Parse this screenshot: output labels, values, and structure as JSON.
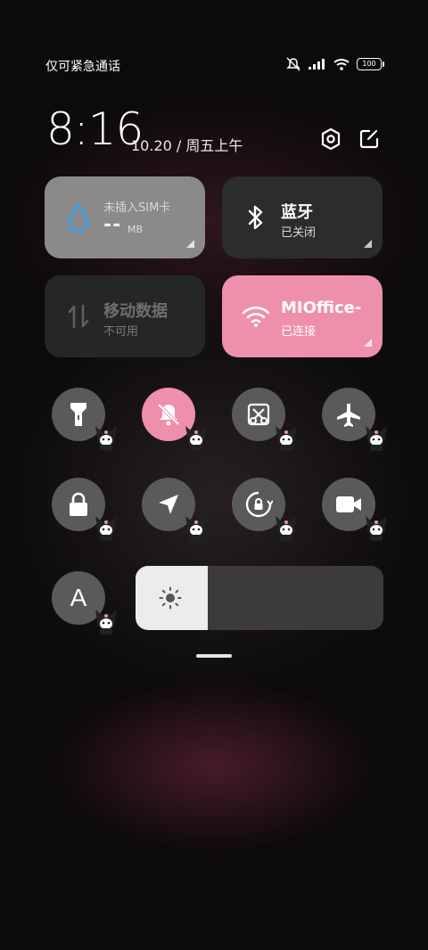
{
  "status_bar": {
    "carrier": "仅可紧急通话",
    "battery": "100"
  },
  "header": {
    "time": "8:16",
    "date": "10.20 / 周五上午"
  },
  "tiles": {
    "data_usage": {
      "title": "未插入SIM卡",
      "value": "--",
      "unit": "MB"
    },
    "bluetooth": {
      "title": "蓝牙",
      "status": "已关闭"
    },
    "mobile_data": {
      "title": "移动数据",
      "status": "不可用"
    },
    "wifi": {
      "title": "MIOffice-",
      "status": "已连接"
    }
  },
  "toggles": [
    {
      "name": "flashlight",
      "active": false
    },
    {
      "name": "silent",
      "active": true
    },
    {
      "name": "screenshot",
      "active": false
    },
    {
      "name": "airplane-mode",
      "active": false
    },
    {
      "name": "lock-screen",
      "active": false
    },
    {
      "name": "location",
      "active": false
    },
    {
      "name": "rotation-lock",
      "active": false
    },
    {
      "name": "screen-recorder",
      "active": false
    },
    {
      "name": "font-size",
      "active": false,
      "label": "A"
    }
  ],
  "brightness": {
    "level": 0.29
  },
  "colors": {
    "accent_pink": "#ee8fac",
    "tile_dark": "#2a2c2d",
    "tile_gray": "#8a8a8a"
  }
}
